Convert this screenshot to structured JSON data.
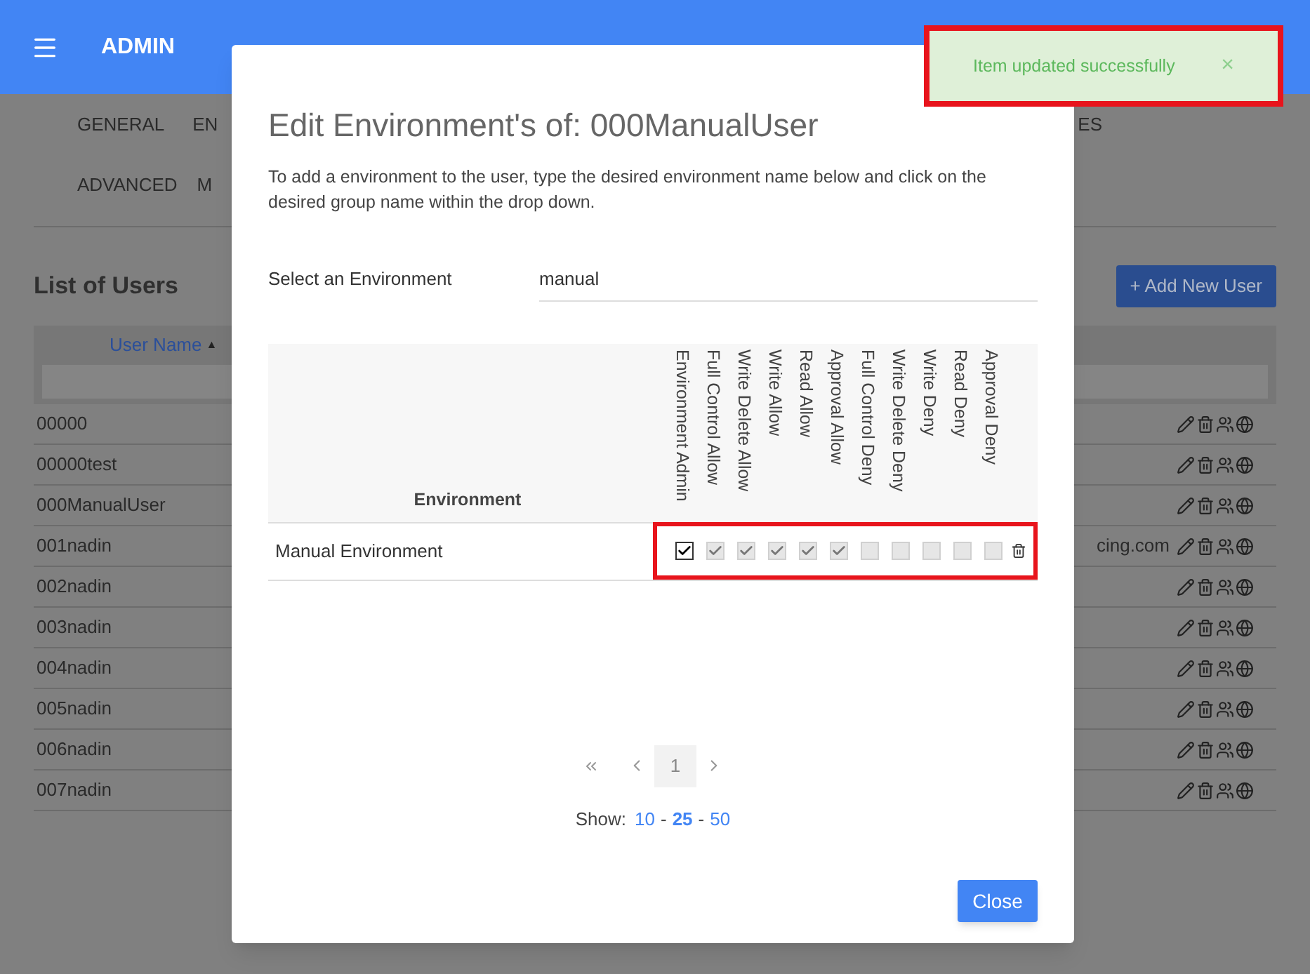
{
  "header": {
    "title": "ADMIN"
  },
  "tabs": [
    [
      {
        "label": "GENERAL"
      },
      {
        "label": "EN"
      },
      {
        "label": "ES"
      }
    ],
    [
      {
        "label": "ADVANCED"
      },
      {
        "label": "M"
      }
    ]
  ],
  "users": {
    "title": "List of Users",
    "add_button": "+ Add New User",
    "column": "User Name",
    "sort_indicator": "▲",
    "rows": [
      {
        "user_name": "00000"
      },
      {
        "user_name": "00000test"
      },
      {
        "user_name": "000ManualUser"
      },
      {
        "user_name": "001nadin",
        "column_2": "cing.com"
      },
      {
        "user_name": "002nadin"
      },
      {
        "user_name": "003nadin"
      },
      {
        "user_name": "004nadin"
      },
      {
        "user_name": "005nadin"
      },
      {
        "user_name": "006nadin"
      },
      {
        "user_name": "007nadin"
      }
    ]
  },
  "modal": {
    "title": "Edit Environment's of: 000ManualUser",
    "description": "To add a environment to the user, type the desired environment name below and click on the desired group name within the drop down.",
    "field_label": "Select an Environment",
    "field_value": "manual",
    "environment_column": "Environment",
    "permission_columns": [
      "Environment Admin",
      "Full Control Allow",
      "Write Delete Allow",
      "Write Allow",
      "Read Allow",
      "Approval Allow",
      "Full Control Deny",
      "Write Delete Deny",
      "Write Deny",
      "Read Deny",
      "Approval Deny"
    ],
    "rows": [
      {
        "environment": "Manual Environment",
        "highlighted": true,
        "permissions": [
          {
            "checked": true,
            "disabled": false
          },
          {
            "checked": true,
            "disabled": true
          },
          {
            "checked": true,
            "disabled": true
          },
          {
            "checked": true,
            "disabled": true
          },
          {
            "checked": true,
            "disabled": true
          },
          {
            "checked": true,
            "disabled": true
          },
          {
            "checked": false,
            "disabled": true
          },
          {
            "checked": false,
            "disabled": true
          },
          {
            "checked": false,
            "disabled": true
          },
          {
            "checked": false,
            "disabled": true
          },
          {
            "checked": false,
            "disabled": true
          }
        ]
      }
    ],
    "pages": [
      {
        "label": "1",
        "selected": true
      }
    ],
    "show_label": "Show:",
    "separator": "-",
    "page_sizes": [
      {
        "label": "10",
        "selected": false
      },
      {
        "label": "25",
        "selected": true
      },
      {
        "label": "50",
        "selected": false
      }
    ],
    "close_button": "Close"
  },
  "toast": {
    "message": "Item updated successfully",
    "close": "×",
    "highlighted": true
  }
}
